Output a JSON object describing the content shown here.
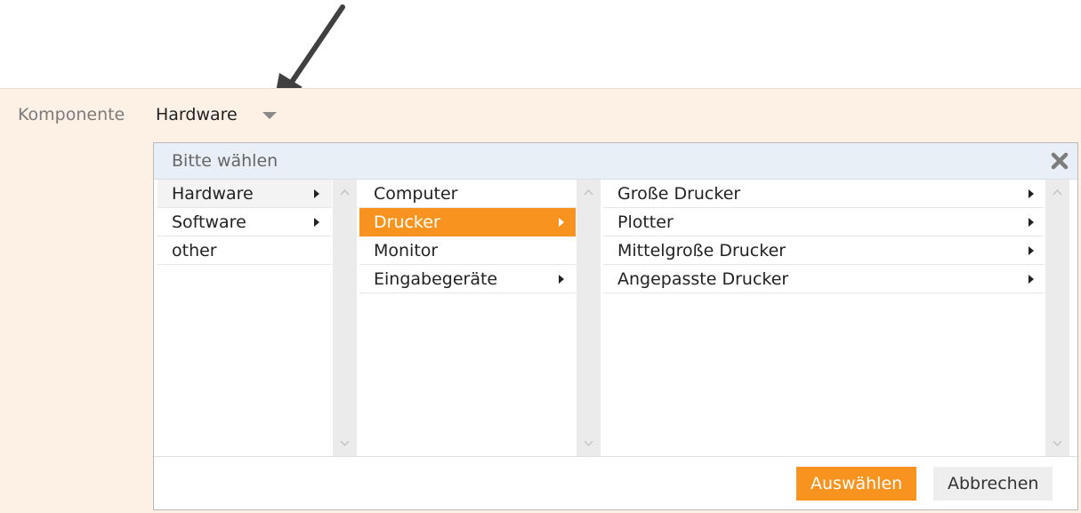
{
  "field": {
    "label": "Komponente",
    "value": "Hardware",
    "caret_icon": "dropdown-caret-icon"
  },
  "dialog": {
    "title": "Bitte wählen",
    "close_icon": "close-icon",
    "columns": [
      {
        "items": [
          {
            "label": "Hardware",
            "has_children": true,
            "state": "hover"
          },
          {
            "label": "Software",
            "has_children": true,
            "state": "normal"
          },
          {
            "label": "other",
            "has_children": false,
            "state": "normal"
          }
        ]
      },
      {
        "items": [
          {
            "label": "Computer",
            "has_children": false,
            "state": "normal"
          },
          {
            "label": "Drucker",
            "has_children": true,
            "state": "selected"
          },
          {
            "label": "Monitor",
            "has_children": false,
            "state": "normal"
          },
          {
            "label": "Eingabegeräte",
            "has_children": true,
            "state": "normal"
          }
        ]
      },
      {
        "items": [
          {
            "label": "Große Drucker",
            "has_children": true,
            "state": "normal"
          },
          {
            "label": "Plotter",
            "has_children": true,
            "state": "normal"
          },
          {
            "label": "Mittelgroße Drucker",
            "has_children": true,
            "state": "normal"
          },
          {
            "label": "Angepasste Drucker",
            "has_children": true,
            "state": "normal"
          }
        ]
      }
    ],
    "buttons": {
      "select_label": "Auswählen",
      "cancel_label": "Abbrechen"
    }
  },
  "colors": {
    "accent": "#f7931e",
    "band": "#fdf1e6",
    "header": "#e9eff6"
  }
}
